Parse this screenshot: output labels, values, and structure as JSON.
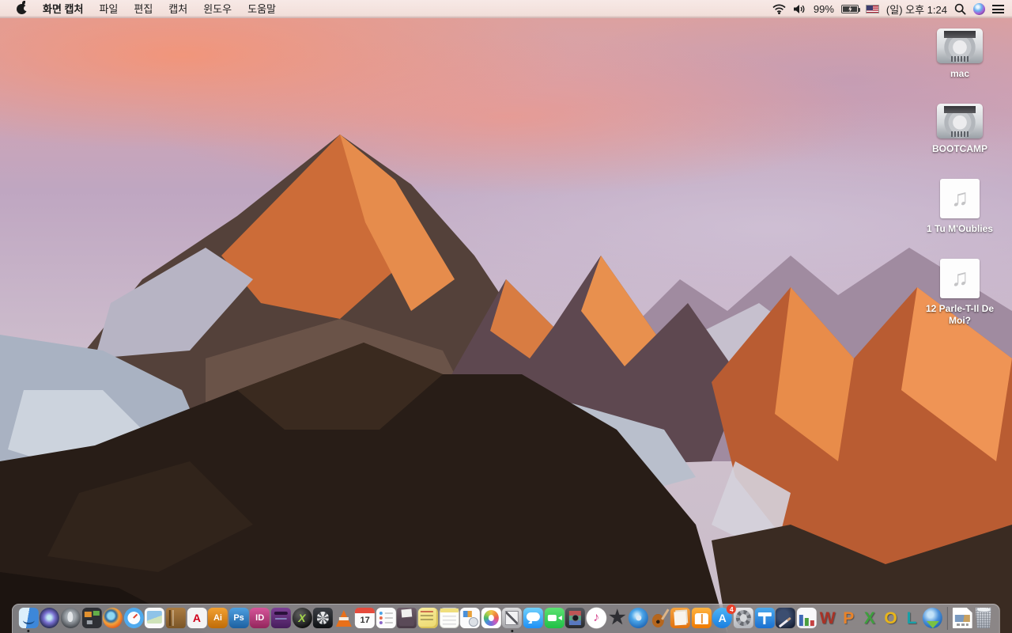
{
  "menu_bar": {
    "app_menu": {
      "items": [
        "화면 캡처",
        "파일",
        "편집",
        "캡처",
        "윈도우",
        "도움말"
      ]
    },
    "status": {
      "battery_percent": "99%",
      "battery_state": "charging",
      "input_source": "US",
      "clock": "(일) 오후 1:24",
      "icons": [
        "wifi-icon",
        "volume-icon",
        "battery-icon",
        "input-flag-icon",
        "search-icon",
        "siri-icon",
        "notification-center-icon"
      ]
    }
  },
  "desktop": {
    "icons": [
      {
        "label": "mac",
        "type": "hard-drive"
      },
      {
        "label": "BOOTCAMP",
        "type": "hard-drive"
      },
      {
        "label": "1 Tu M'Oublies",
        "type": "audio-file",
        "glyph": "♫"
      },
      {
        "label": "12 Parle-T-Il De Moi?",
        "type": "audio-file",
        "glyph": "♫"
      }
    ]
  },
  "dock": {
    "items": [
      {
        "name": "finder",
        "running": true
      },
      {
        "name": "siri"
      },
      {
        "name": "launchpad"
      },
      {
        "name": "mission-control"
      },
      {
        "name": "firefox"
      },
      {
        "name": "safari"
      },
      {
        "name": "preview"
      },
      {
        "name": "contacts"
      },
      {
        "name": "acrobat",
        "glyph": "A"
      },
      {
        "name": "illustrator",
        "glyph": "Ai"
      },
      {
        "name": "photoshop",
        "glyph": "Ps"
      },
      {
        "name": "indesign",
        "glyph": "ID"
      },
      {
        "name": "toast"
      },
      {
        "name": "x-ball",
        "glyph": "X"
      },
      {
        "name": "fan-disk"
      },
      {
        "name": "vlc"
      },
      {
        "name": "calendar",
        "glyph": "17"
      },
      {
        "name": "reminders"
      },
      {
        "name": "scanner"
      },
      {
        "name": "stickies"
      },
      {
        "name": "notepad"
      },
      {
        "name": "template-doc"
      },
      {
        "name": "photos"
      },
      {
        "name": "screen-capture",
        "running": true
      },
      {
        "name": "messages"
      },
      {
        "name": "facetime"
      },
      {
        "name": "photo-booth"
      },
      {
        "name": "itunes",
        "glyph": "♪"
      },
      {
        "name": "imovie",
        "glyph": "★"
      },
      {
        "name": "dvd"
      },
      {
        "name": "garageband"
      },
      {
        "name": "news"
      },
      {
        "name": "ibooks"
      },
      {
        "name": "app-store",
        "glyph": "A",
        "badge": "4"
      },
      {
        "name": "system-preferences"
      },
      {
        "name": "keynote"
      },
      {
        "name": "pen"
      },
      {
        "name": "office-chart"
      },
      {
        "name": "word",
        "glyph": "W",
        "letter": true
      },
      {
        "name": "powerpoint",
        "glyph": "P",
        "letter": true
      },
      {
        "name": "excel",
        "glyph": "X",
        "letter": true
      },
      {
        "name": "outlook",
        "glyph": "O",
        "letter": true
      },
      {
        "name": "lync",
        "glyph": "L",
        "letter": true
      },
      {
        "name": "web-download"
      },
      {
        "name": "separator"
      },
      {
        "name": "recent-document"
      },
      {
        "name": "trash",
        "state": "full"
      }
    ]
  },
  "colors": {
    "menubar_bg": "#f4e3df",
    "sky_pink": "#e89a8c",
    "sky_lavender": "#c8b5c9",
    "mountain_orange": "#cc6c38",
    "rock_dark": "#281d17",
    "dock_bg": "rgba(215,219,228,0.52)"
  }
}
